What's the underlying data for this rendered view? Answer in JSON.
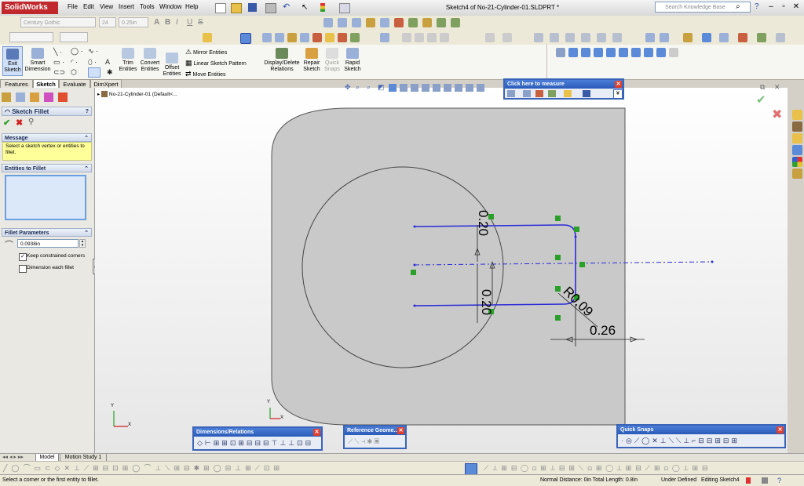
{
  "app": {
    "logo": "SolidWorks",
    "menus": [
      "File",
      "Edit",
      "View",
      "Insert",
      "Tools",
      "Window",
      "Help"
    ],
    "document_title": "Sketch4 of No-21-Cylinder-01.SLDPRT *",
    "search_placeholder": "Search Knowledge Base"
  },
  "format_bar": {
    "font": "Century Gothic",
    "size": "24",
    "height": "0.25in",
    "bold": "B",
    "italic": "I",
    "underline": "U",
    "strike": "S",
    "text_bold": "A"
  },
  "command_manager": {
    "exit_sketch": "Exit Sketch",
    "smart_dimension": "Smart Dimension",
    "trim_entities": "Trim Entities",
    "convert_entities": "Convert Entities",
    "offset_entities": "Offset Entities",
    "mirror_entities": "Mirror Entities",
    "linear_sketch_pattern": "Linear Sketch Pattern",
    "move_entities": "Move Entities",
    "display_delete_relations": "Display/Delete Relations",
    "repair_sketch": "Repair Sketch",
    "quick_snaps": "Quick Snaps",
    "rapid_sketch": "Rapid Sketch"
  },
  "cm_tabs": [
    "Features",
    "Sketch",
    "Evaluate",
    "DimXpert"
  ],
  "property_manager": {
    "title": "Sketch Fillet",
    "help": "?",
    "message_header": "Message",
    "message_text": "Select a sketch vertex or entities to fillet.",
    "entities_header": "Entities to Fillet",
    "params_header": "Fillet Parameters",
    "radius_value": "0.0938in",
    "keep_corners": "Keep constrained corners",
    "keep_corners_checked": true,
    "dimension_each": "Dimension each fillet",
    "dimension_each_checked": false
  },
  "feature_tree": {
    "part_name": "No-21-Cylinder-01  (Default<..."
  },
  "dimensions": {
    "top": "0.20",
    "bottom": "0.20",
    "radius": "R0.09",
    "width": "0.26"
  },
  "axes": {
    "x": "X",
    "y": "Y"
  },
  "measure_toolbar": {
    "title": "Click here to measure"
  },
  "float_toolbars": {
    "dimensions": "Dimensions/Relations",
    "reference": "Reference Geome...",
    "snaps": "Quick Snaps"
  },
  "model_tabs": [
    "Model",
    "Motion Study 1"
  ],
  "status": {
    "prompt": "Select a corner or the first entity to fillet.",
    "measure": "Normal Distance: 0in Total Length: 0.8in",
    "state": "Under Defined",
    "editing": "Editing Sketch4"
  },
  "colors": {
    "sketch_blue": "#2a2ad8",
    "relation_green": "#2aa02a",
    "accent": "#c0282d"
  }
}
